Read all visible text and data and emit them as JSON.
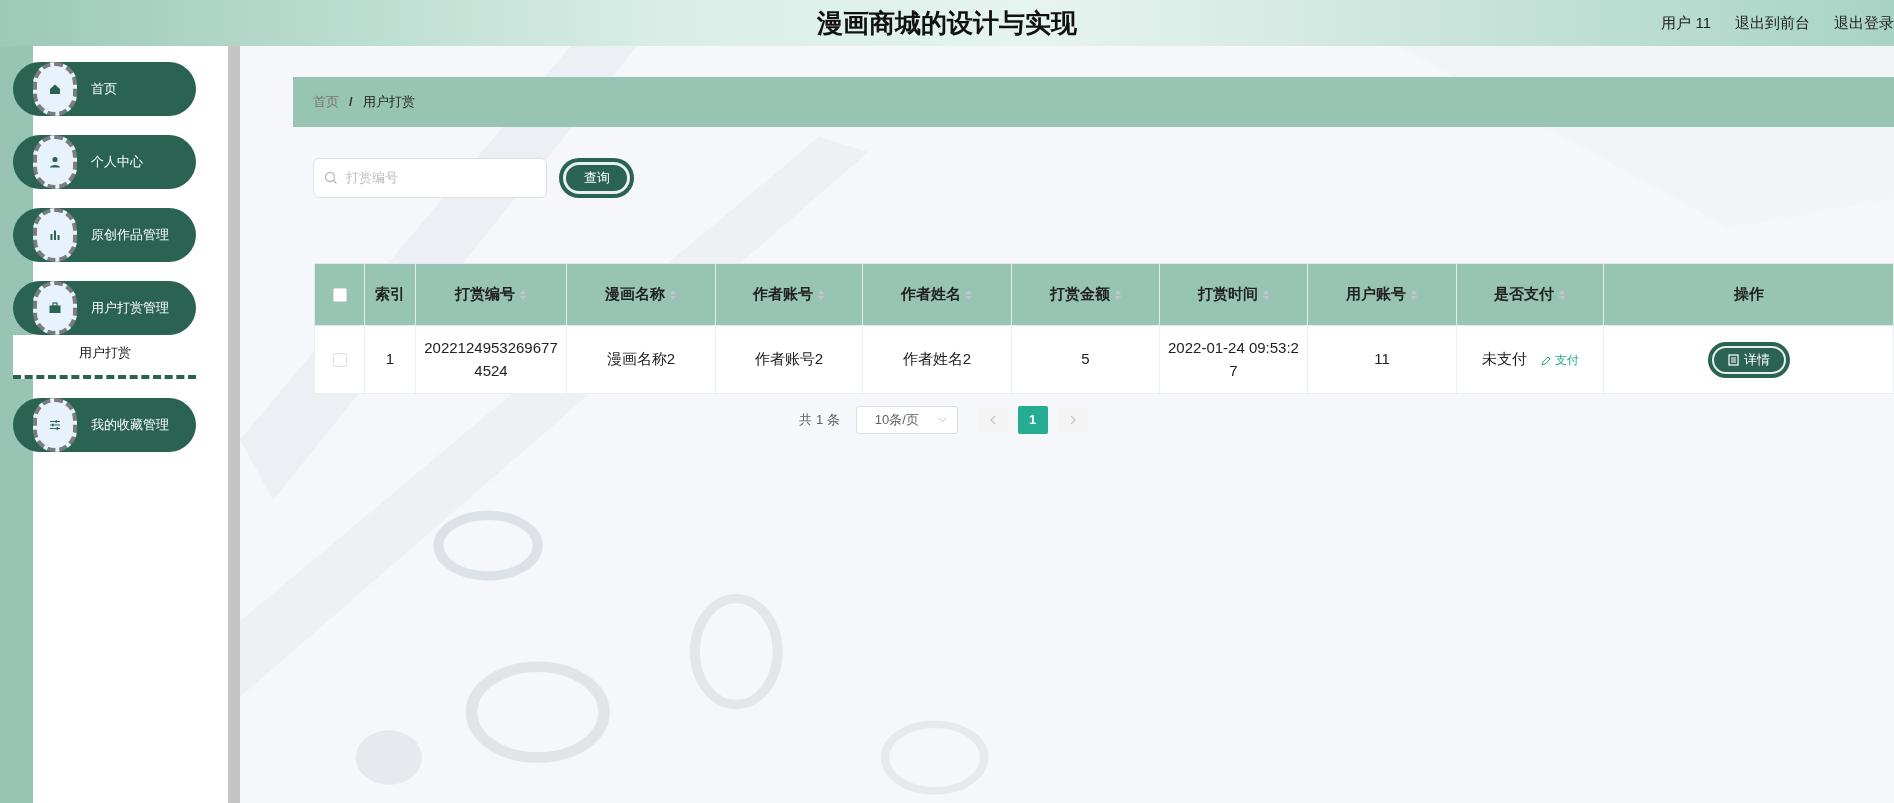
{
  "header": {
    "title": "漫画商城的设计与实现",
    "links": [
      "用户 11",
      "退出到前台",
      "退出登录"
    ]
  },
  "sidebar": {
    "items": [
      {
        "label": "首页",
        "kind": "home"
      },
      {
        "label": "个人中心",
        "kind": "user"
      },
      {
        "label": "原创作品管理",
        "kind": "chart"
      },
      {
        "label": "用户打赏管理",
        "kind": "briefcase",
        "children": [
          {
            "label": "用户打赏"
          }
        ]
      },
      {
        "label": "我的收藏管理",
        "kind": "sliders"
      }
    ]
  },
  "breadcrumb": {
    "separator": "/",
    "items": [
      {
        "label": "首页",
        "current": false
      },
      {
        "label": "用户打赏",
        "current": true
      }
    ]
  },
  "search": {
    "placeholder": "打赏编号",
    "button": "查询"
  },
  "table": {
    "all_checked": false,
    "columns": [
      {
        "label": "索引",
        "sortable": false
      },
      {
        "label": "打赏编号",
        "sortable": true
      },
      {
        "label": "漫画名称",
        "sortable": true
      },
      {
        "label": "作者账号",
        "sortable": true
      },
      {
        "label": "作者姓名",
        "sortable": true
      },
      {
        "label": "打赏金额",
        "sortable": true
      },
      {
        "label": "打赏时间",
        "sortable": true
      },
      {
        "label": "用户账号",
        "sortable": true
      },
      {
        "label": "是否支付",
        "sortable": true
      },
      {
        "label": "操作",
        "sortable": false
      }
    ],
    "rows": [
      {
        "checked": false,
        "cells": [
          "1",
          "20221249532696774524",
          "漫画名称2",
          "作者账号2",
          "作者姓名2",
          "5",
          "2022-01-24 09:53:27",
          "11"
        ],
        "paid": "未支付",
        "pay_link": "支付",
        "action": "详情"
      }
    ]
  },
  "pagination": {
    "total": "共 1 条",
    "page_size": "10条/页",
    "pages": [
      {
        "label": "1",
        "selected": true
      }
    ]
  }
}
